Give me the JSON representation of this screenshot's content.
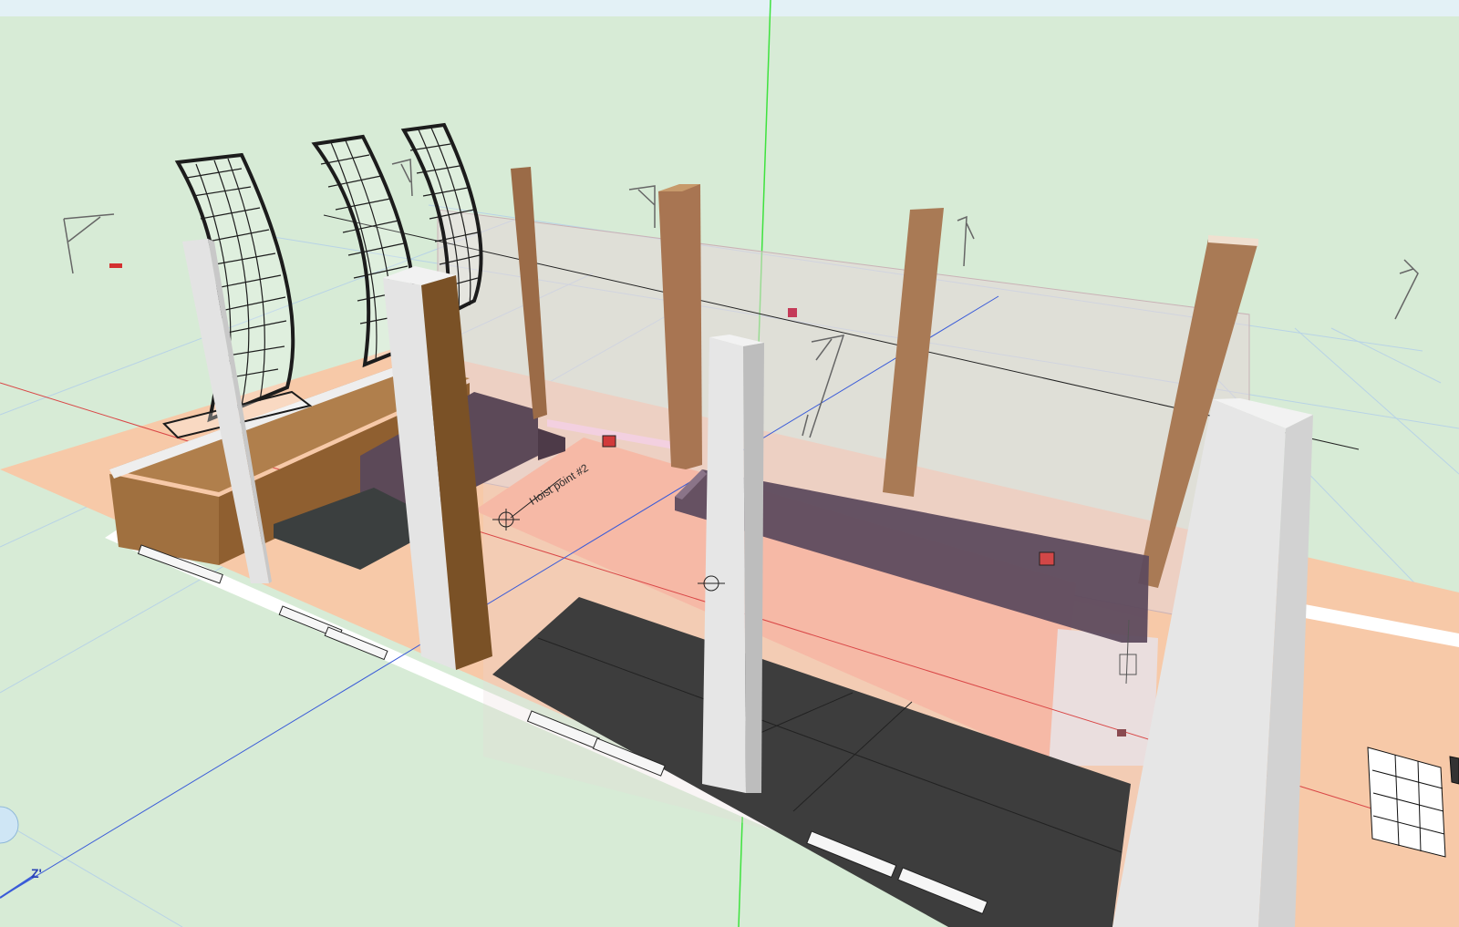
{
  "viewport": {
    "background": "#d7ebd6",
    "topbar_color": "#e3f1f6"
  },
  "labels": {
    "hoist_point": "Hoist point #2",
    "axis_label": "Z'"
  },
  "colors": {
    "floor_peach": "#f7c9a8",
    "stage_salmon": "#f6b9a6",
    "column_brown": "#9b6b47",
    "column_light": "#e9e9e9",
    "platform_purple": "#5e4b5e",
    "riser_brown": "#a0703f",
    "mat_dark": "#3f3f3f",
    "truss_grid": "#1c1c1c",
    "axis_green": "#3ee23e",
    "axis_blue": "#3a5bd8",
    "axis_red": "#d94646"
  },
  "icons": [
    "lighting-fixture-icon",
    "hoist-icon",
    "clamp-icon",
    "navigation-cube-icon",
    "legend-sheet-icon"
  ]
}
